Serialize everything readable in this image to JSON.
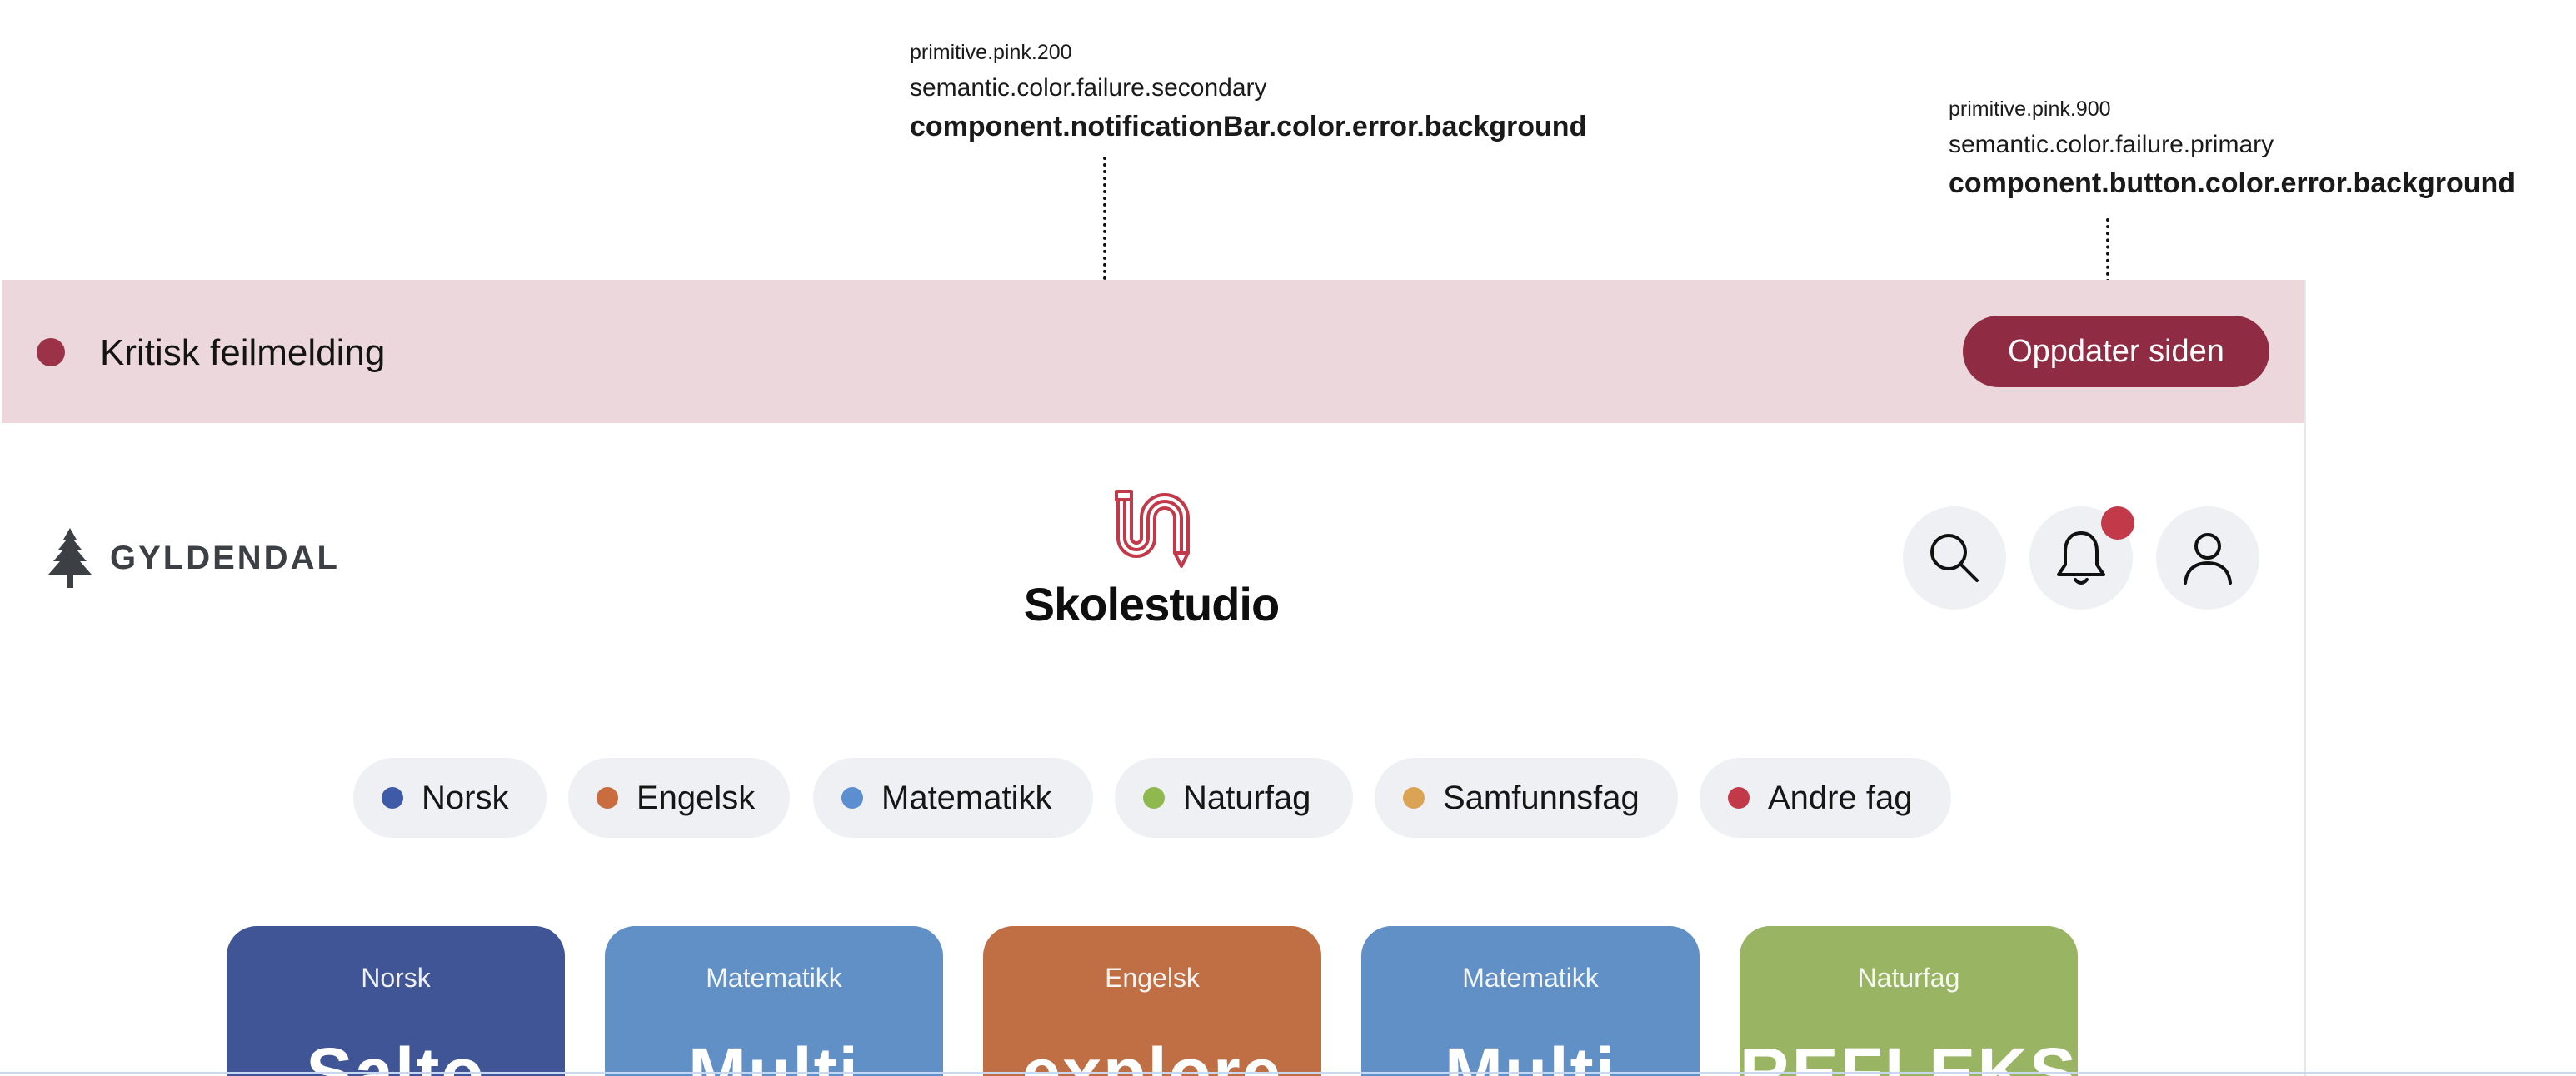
{
  "annotations": [
    {
      "primitive": "primitive.pink.200",
      "semantic": "semantic.color.failure.secondary",
      "component": "component.notificationBar.color.error.background"
    },
    {
      "primitive": "primitive.pink.900",
      "semantic": "semantic.color.failure.primary",
      "component": "component.button.color.error.background"
    }
  ],
  "notification": {
    "message": "Kritisk feilmelding",
    "button_label": "Oppdater siden",
    "background": "#ecd7dc",
    "accent": "#8f2b42"
  },
  "header": {
    "publisher_logo": "GYLDENDAL",
    "app_name": "Skolestudio",
    "icons": [
      "search-icon",
      "bell-icon",
      "user-icon"
    ],
    "notification_badge_color": "#c23a4a"
  },
  "subjects": [
    {
      "label": "Norsk",
      "color": "#3f5aa6"
    },
    {
      "label": "Engelsk",
      "color": "#c96c40"
    },
    {
      "label": "Matematikk",
      "color": "#5b8fd0"
    },
    {
      "label": "Naturfag",
      "color": "#8fb84f"
    },
    {
      "label": "Samfunnsfag",
      "color": "#dba455"
    },
    {
      "label": "Andre fag",
      "color": "#c23a4a"
    }
  ],
  "cards": [
    {
      "category": "Norsk",
      "title": "Salto",
      "color": "#405595"
    },
    {
      "category": "Matematikk",
      "title": "Multi",
      "color": "#6190c6"
    },
    {
      "category": "Engelsk",
      "title": "explore",
      "color": "#c06f45"
    },
    {
      "category": "Matematikk",
      "title": "Multi",
      "color": "#6190c6"
    },
    {
      "category": "Naturfag",
      "title": "REFLEKS",
      "color": "#99b563"
    }
  ]
}
